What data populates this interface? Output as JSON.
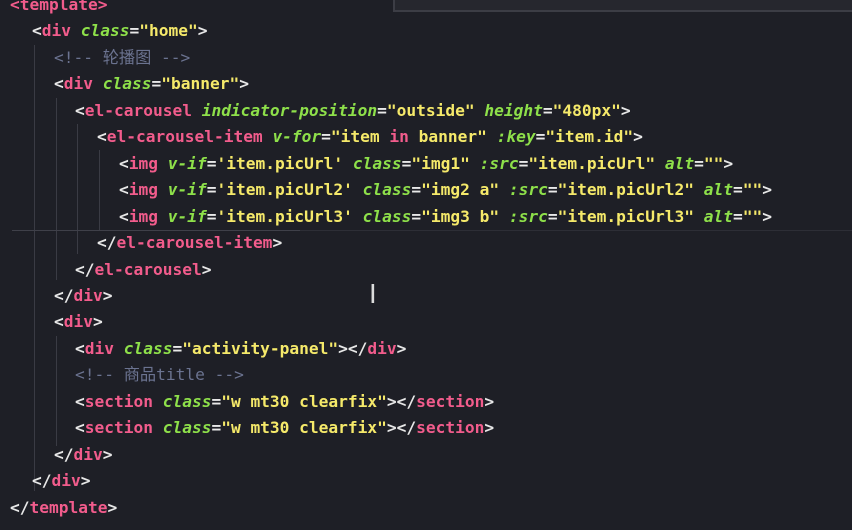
{
  "cursor_glyph": "I",
  "lines": [
    {
      "segments": [
        [
          "tag",
          "<template>"
        ]
      ]
    },
    {
      "segments": [
        [
          "punc",
          "<"
        ],
        [
          "tag",
          "div "
        ],
        [
          "attr",
          "class"
        ],
        [
          "punc",
          "="
        ],
        [
          "str",
          "\"home\""
        ],
        [
          "punc",
          ">"
        ]
      ]
    },
    {
      "segments": [
        [
          "comment",
          "<!-- 轮播图 -->"
        ]
      ]
    },
    {
      "segments": [
        [
          "punc",
          "<"
        ],
        [
          "tag",
          "div "
        ],
        [
          "attr",
          "class"
        ],
        [
          "punc",
          "="
        ],
        [
          "str",
          "\"banner\""
        ],
        [
          "punc",
          ">"
        ]
      ]
    },
    {
      "segments": [
        [
          "punc",
          "<"
        ],
        [
          "tag",
          "el-carousel "
        ],
        [
          "attr",
          "indicator-position"
        ],
        [
          "punc",
          "="
        ],
        [
          "str",
          "\"outside\" "
        ],
        [
          "attr",
          "height"
        ],
        [
          "punc",
          "="
        ],
        [
          "str",
          "\"480px\""
        ],
        [
          "punc",
          ">"
        ]
      ]
    },
    {
      "segments": [
        [
          "punc",
          "<"
        ],
        [
          "tag",
          "el-carousel-item "
        ],
        [
          "attr",
          "v-for"
        ],
        [
          "punc",
          "="
        ],
        [
          "str",
          "\"item "
        ],
        [
          "kw",
          "in"
        ],
        [
          "str",
          " banner\" "
        ],
        [
          "attr",
          ":key"
        ],
        [
          "punc",
          "="
        ],
        [
          "str",
          "\"item.id\""
        ],
        [
          "punc",
          ">"
        ]
      ]
    },
    {
      "segments": [
        [
          "punc",
          "<"
        ],
        [
          "tag",
          "img "
        ],
        [
          "attr",
          "v-if"
        ],
        [
          "punc",
          "="
        ],
        [
          "str",
          "'item.picUrl' "
        ],
        [
          "attr",
          "class"
        ],
        [
          "punc",
          "="
        ],
        [
          "str",
          "\"img1\" "
        ],
        [
          "attr",
          ":src"
        ],
        [
          "punc",
          "="
        ],
        [
          "str",
          "\"item.picUrl\" "
        ],
        [
          "attr",
          "alt"
        ],
        [
          "punc",
          "="
        ],
        [
          "str",
          "\"\""
        ],
        [
          "punc",
          ">"
        ]
      ]
    },
    {
      "segments": [
        [
          "punc",
          "<"
        ],
        [
          "tag",
          "img "
        ],
        [
          "attr",
          "v-if"
        ],
        [
          "punc",
          "="
        ],
        [
          "str",
          "'item.picUrl2' "
        ],
        [
          "attr",
          "class"
        ],
        [
          "punc",
          "="
        ],
        [
          "str",
          "\"img2 a\" "
        ],
        [
          "attr",
          ":src"
        ],
        [
          "punc",
          "="
        ],
        [
          "str",
          "\"item.picUrl2\" "
        ],
        [
          "attr",
          "alt"
        ],
        [
          "punc",
          "="
        ],
        [
          "str",
          "\"\""
        ],
        [
          "punc",
          ">"
        ]
      ]
    },
    {
      "segments": [
        [
          "punc",
          "<"
        ],
        [
          "tag",
          "img "
        ],
        [
          "attr",
          "v-if"
        ],
        [
          "punc",
          "="
        ],
        [
          "str",
          "'item.picUrl3' "
        ],
        [
          "attr",
          "class"
        ],
        [
          "punc",
          "="
        ],
        [
          "str",
          "\"img3 b\" "
        ],
        [
          "attr",
          ":src"
        ],
        [
          "punc",
          "="
        ],
        [
          "str",
          "\"item.picUrl3\" "
        ],
        [
          "attr",
          "alt"
        ],
        [
          "punc",
          "="
        ],
        [
          "str",
          "\"\""
        ],
        [
          "punc",
          ">"
        ]
      ]
    },
    {
      "segments": [
        [
          "punc",
          "</"
        ],
        [
          "tag",
          "el-carousel-item"
        ],
        [
          "punc",
          ">"
        ]
      ]
    },
    {
      "segments": [
        [
          "punc",
          "</"
        ],
        [
          "tag",
          "el-carousel"
        ],
        [
          "punc",
          ">"
        ]
      ]
    },
    {
      "segments": [
        [
          "punc",
          "</"
        ],
        [
          "tag",
          "div"
        ],
        [
          "punc",
          ">"
        ]
      ]
    },
    {
      "segments": [
        [
          "punc",
          "<"
        ],
        [
          "tag",
          "div"
        ],
        [
          "punc",
          ">"
        ]
      ]
    },
    {
      "segments": [
        [
          "punc",
          "<"
        ],
        [
          "tag",
          "div "
        ],
        [
          "attr",
          "class"
        ],
        [
          "punc",
          "="
        ],
        [
          "str",
          "\"activity-panel\""
        ],
        [
          "punc",
          "></"
        ],
        [
          "tag",
          "div"
        ],
        [
          "punc",
          ">"
        ]
      ]
    },
    {
      "segments": [
        [
          "comment",
          "<!-- 商品title -->"
        ]
      ]
    },
    {
      "segments": [
        [
          "punc",
          "<"
        ],
        [
          "tag",
          "section "
        ],
        [
          "attr",
          "class"
        ],
        [
          "punc",
          "="
        ],
        [
          "str",
          "\"w mt30 clearfix\""
        ],
        [
          "punc",
          "></"
        ],
        [
          "tag",
          "section"
        ],
        [
          "punc",
          ">"
        ]
      ]
    },
    {
      "segments": [
        [
          "punc",
          "<"
        ],
        [
          "tag",
          "section "
        ],
        [
          "attr",
          "class"
        ],
        [
          "punc",
          "="
        ],
        [
          "str",
          "\"w mt30 clearfix\""
        ],
        [
          "punc",
          "></"
        ],
        [
          "tag",
          "section"
        ],
        [
          "punc",
          ">"
        ]
      ]
    },
    {
      "segments": [
        [
          "punc",
          "</"
        ],
        [
          "tag",
          "div"
        ],
        [
          "punc",
          ">"
        ]
      ]
    },
    {
      "segments": [
        [
          "punc",
          "</"
        ],
        [
          "tag",
          "div"
        ],
        [
          "punc",
          ">"
        ]
      ]
    },
    {
      "segments": [
        [
          "punc",
          "</"
        ],
        [
          "tag",
          "template"
        ],
        [
          "punc",
          ">"
        ]
      ]
    }
  ],
  "colors": {
    "background": "#1e1f26",
    "tag": "#f25c8c",
    "attribute": "#8ee04a",
    "string": "#f5e96a",
    "comment": "#6b7390",
    "punctuation": "#e8e8e8"
  }
}
